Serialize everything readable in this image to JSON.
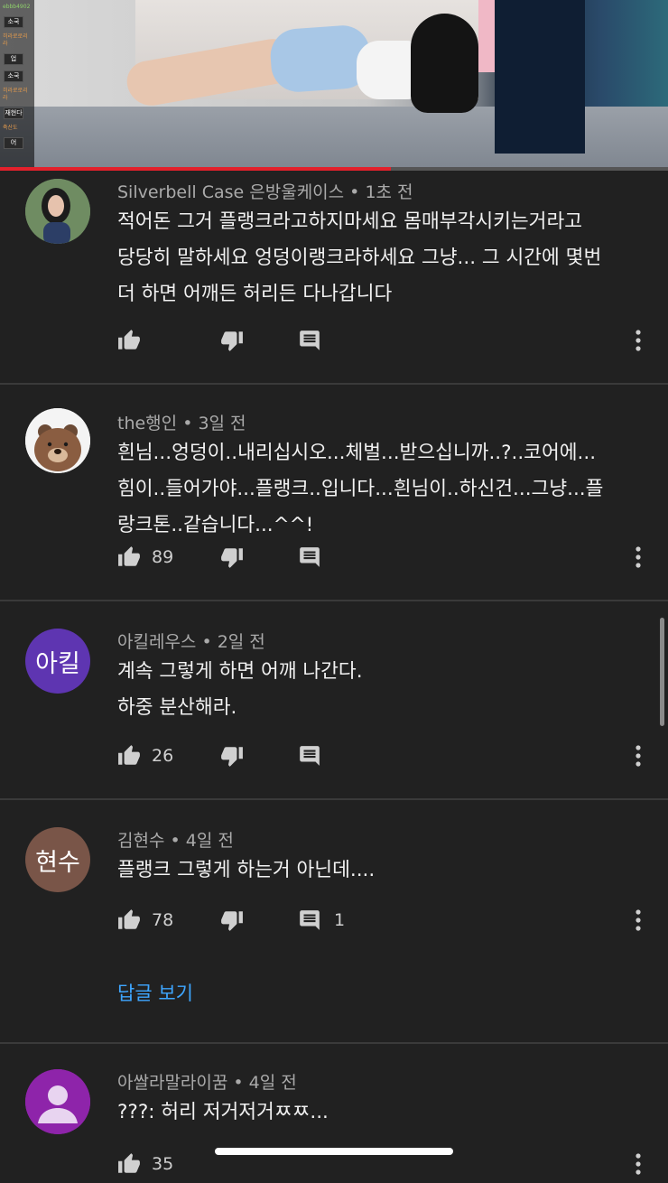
{
  "video": {
    "chat_items": [
      "ebbb4902",
      "소국",
      "히라로로리라",
      "업",
      "소국",
      "히라로로리라",
      "재현다",
      "축산도",
      "어"
    ],
    "progress_fraction": 0.585
  },
  "comments": [
    {
      "author": "Silverbell Case 은방울케이스",
      "time": "1초 전",
      "text": "적어돈 그거 플랭크라고하지마세요 몸매부각시키는거라고\n당당히 말하세요 엉덩이랭크라하세요 그냥... 그 시간에 몇번\n더 하면 어깨든 허리든 다나갑니다",
      "likes": "",
      "replies": ""
    },
    {
      "author": "the행인",
      "time": "3일 전",
      "text": "흰님...엉덩이..내리십시오...체벌...받으십니까..?..코어에...\n힘이..들어가야...플랭크..입니다...흰님이..하신건...그냥...플\n랑크톤..같습니다...^^!",
      "likes": "89",
      "replies": ""
    },
    {
      "author": "아킬레우스",
      "time": "2일 전",
      "avatar_text": "아킬",
      "text": "계속 그렇게 하면 어깨 나간다.\n하중 분산해라.",
      "likes": "26",
      "replies": ""
    },
    {
      "author": "김현수",
      "time": "4일 전",
      "avatar_text": "현수",
      "text": "플랭크 그렇게 하는거 아닌데....",
      "likes": "78",
      "replies": "1",
      "view_replies": "답글 보기"
    },
    {
      "author": "아쌀라말라이꿈",
      "time": "4일 전",
      "text": "???: 허리 저거저거ㅉㅉ...",
      "likes": "35",
      "replies": ""
    }
  ],
  "separator": " • ",
  "colors": {
    "background": "#212121",
    "link": "#3ea6ff",
    "progress": "#e3212c",
    "avatar_purple": "#5e35b1",
    "avatar_brown": "#795548",
    "avatar_violet": "#8e24aa"
  },
  "icons": [
    "like-icon",
    "dislike-icon",
    "reply-icon",
    "more-vert-icon"
  ]
}
